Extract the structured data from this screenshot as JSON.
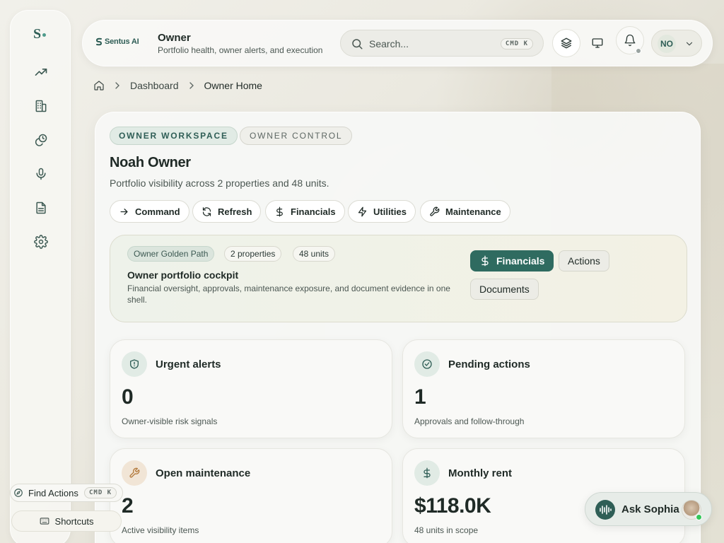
{
  "sidebar": {
    "logo": "S",
    "items": [
      {
        "icon": "trend-up-icon"
      },
      {
        "icon": "building-icon"
      },
      {
        "icon": "coins-icon"
      },
      {
        "icon": "microphone-icon"
      },
      {
        "icon": "document-icon"
      },
      {
        "icon": "settings-icon"
      }
    ]
  },
  "header": {
    "brand": "Sentus AI",
    "title": "Owner",
    "subtitle": "Portfolio health, owner alerts, and execution",
    "search_placeholder": "Search...",
    "search_shortcut": "CMD K",
    "user_initials": "NO"
  },
  "breadcrumb": {
    "items": [
      "Dashboard",
      "Owner Home"
    ]
  },
  "main": {
    "chip_workspace": "OWNER WORKSPACE",
    "chip_control": "OWNER CONTROL",
    "name": "Noah Owner",
    "description": "Portfolio visibility across 2 properties and 48 units.",
    "quick_actions": [
      "Command",
      "Refresh",
      "Financials",
      "Utilities",
      "Maintenance"
    ],
    "cockpit": {
      "tag_path": "Owner Golden Path",
      "tag_properties": "2 properties",
      "tag_units": "48 units",
      "title": "Owner portfolio cockpit",
      "description": "Financial oversight, approvals, maintenance exposure, and document evidence in one shell.",
      "btn_financials": "Financials",
      "btn_actions": "Actions",
      "btn_documents": "Documents"
    },
    "cards": [
      {
        "title": "Urgent alerts",
        "value": "0",
        "footer": "Owner-visible risk signals"
      },
      {
        "title": "Pending actions",
        "value": "1",
        "footer": "Approvals and follow-through"
      },
      {
        "title": "Open maintenance",
        "value": "2",
        "footer": "Active visibility items"
      },
      {
        "title": "Monthly rent",
        "value": "$118.0K",
        "footer": "48 units in scope"
      }
    ]
  },
  "footer_tools": {
    "find_actions": "Find Actions",
    "find_shortcut": "CMD K",
    "shortcuts": "Shortcuts",
    "ask": "Ask Sophia"
  },
  "colors": {
    "accent": "#2f6b60",
    "accent_light": "#e1ebe5",
    "background": "#eceae2"
  }
}
